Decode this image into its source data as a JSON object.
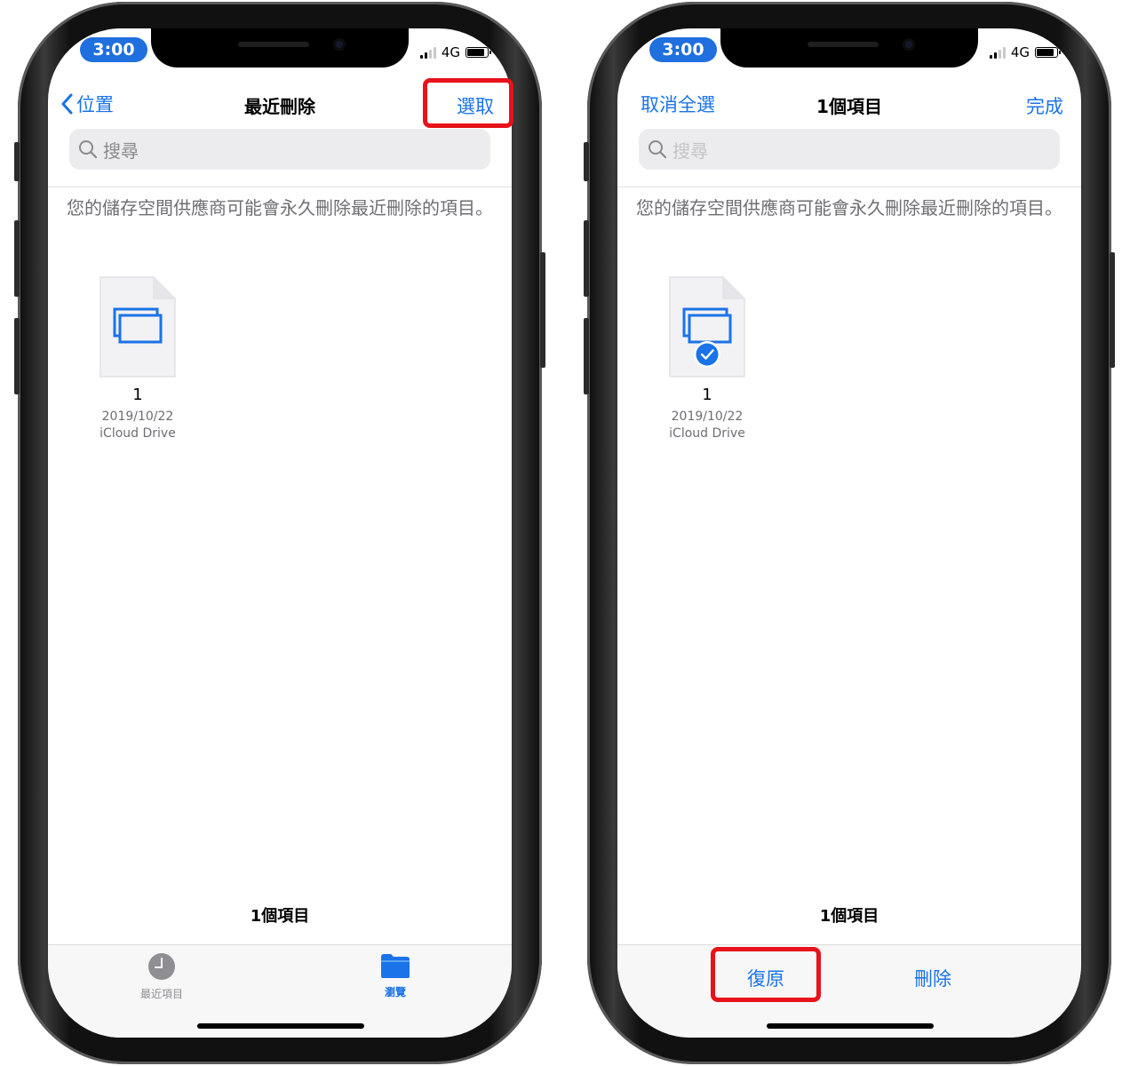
{
  "status_bar": {
    "time": "3:00",
    "network": "4G"
  },
  "left_screen": {
    "nav": {
      "back_label": "位置",
      "title": "最近刪除",
      "action_label": "選取"
    },
    "search": {
      "placeholder": "搜尋"
    },
    "notice": "您的儲存空間供應商可能會永久刪除最近刪除的項目。",
    "file": {
      "name": "1",
      "date": "2019/10/22",
      "location": "iCloud Drive",
      "icon": "screen-mirror-file-icon"
    },
    "count": "1個項目",
    "tabs": [
      {
        "label": "最近項目",
        "icon": "clock-icon"
      },
      {
        "label": "瀏覽",
        "icon": "folder-icon"
      }
    ]
  },
  "right_screen": {
    "nav": {
      "left_label": "取消全選",
      "title": "1個項目",
      "right_label": "完成"
    },
    "search": {
      "placeholder": "搜尋"
    },
    "notice": "您的儲存空間供應商可能會永久刪除最近刪除的項目。",
    "file": {
      "name": "1",
      "date": "2019/10/22",
      "location": "iCloud Drive",
      "selected": true,
      "icon": "checkmark-circle-icon"
    },
    "count": "1個項目",
    "toolbar": {
      "restore_label": "復原",
      "delete_label": "刪除"
    }
  },
  "colors": {
    "accent": "#1a73e8",
    "highlight": "#e8121a",
    "time_pill": "#1f6fde"
  }
}
